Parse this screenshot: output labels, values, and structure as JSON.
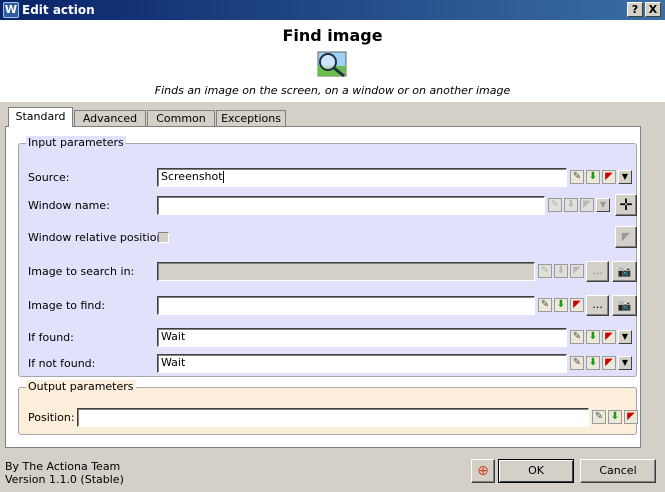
{
  "window": {
    "title": "Edit action",
    "help_label": "?",
    "close_label": "X"
  },
  "header": {
    "action_name": "Find image",
    "description": "Finds an image on the screen, on a window or on another image"
  },
  "tabs": [
    {
      "label": "Standard",
      "active": true
    },
    {
      "label": "Advanced",
      "active": false
    },
    {
      "label": "Common",
      "active": false
    },
    {
      "label": "Exceptions",
      "active": false
    }
  ],
  "input_group": {
    "legend": "Input parameters",
    "source": {
      "label": "Source:",
      "value": "Screenshot"
    },
    "window_name": {
      "label": "Window name:",
      "value": ""
    },
    "window_relative_position": {
      "label": "Window relative position:",
      "checked": false
    },
    "image_to_search_in": {
      "label": "Image to search in:",
      "value": "",
      "browse_label": "..."
    },
    "image_to_find": {
      "label": "Image to find:",
      "value": "",
      "browse_label": "..."
    },
    "if_found": {
      "label": "If found:",
      "value": "Wait"
    },
    "if_not_found": {
      "label": "If not found:",
      "value": "Wait"
    }
  },
  "output_group": {
    "legend": "Output parameters",
    "position": {
      "label": "Position:",
      "value": ""
    }
  },
  "footer": {
    "author": "By The Actiona Team",
    "version": "Version 1.1.0 (Stable)",
    "ok_label": "OK",
    "cancel_label": "Cancel"
  },
  "colors": {
    "title_bar": "#0a246a",
    "input_group_bg": "#e2e1fb",
    "output_group_bg": "#fbefdc",
    "dialog_bg": "#d4d0c8"
  }
}
